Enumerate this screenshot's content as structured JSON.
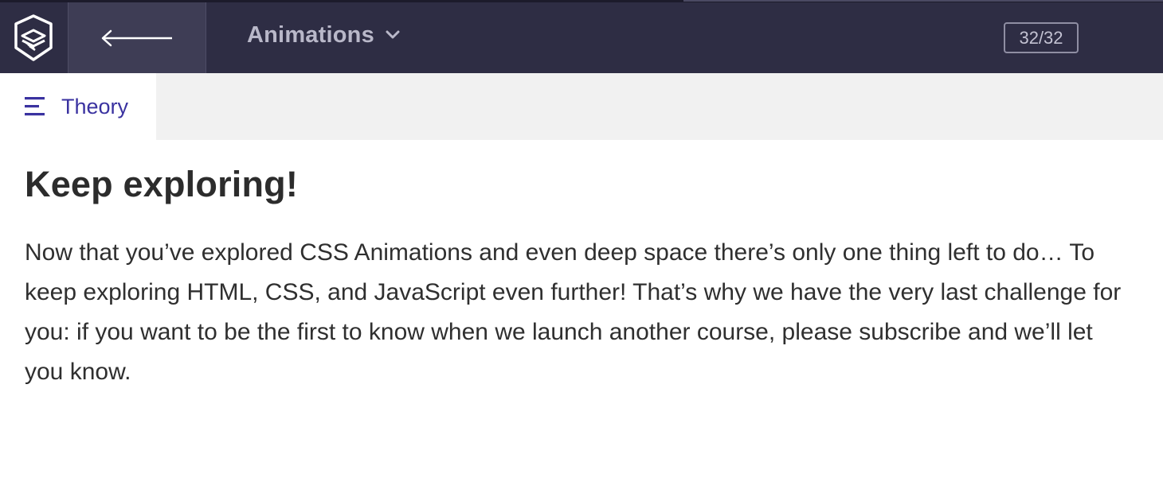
{
  "header": {
    "logo_icon": "shield-book-logo",
    "back_icon": "arrow-left-icon",
    "course_title": "Animations",
    "dropdown_icon": "chevron-down-icon",
    "progress": "32/32"
  },
  "tabs": [
    {
      "label": "Theory",
      "icon": "menu-lines-icon",
      "active": true
    }
  ],
  "lesson": {
    "title": "Keep exploring!",
    "body": "Now that you’ve explored CSS Animations and even deep space there’s only one thing left to do… To keep exploring HTML, CSS, and JavaScript even further! That’s why we have the very last challenge for you: if you want to be the first to know when we launch another course, please subscribe and we’ll let you know."
  },
  "colors": {
    "topbar": "#2e2d44",
    "back_button": "#3e3d55",
    "tab_accent": "#3a32a0",
    "tabbar_bg": "#f1f1f1"
  }
}
